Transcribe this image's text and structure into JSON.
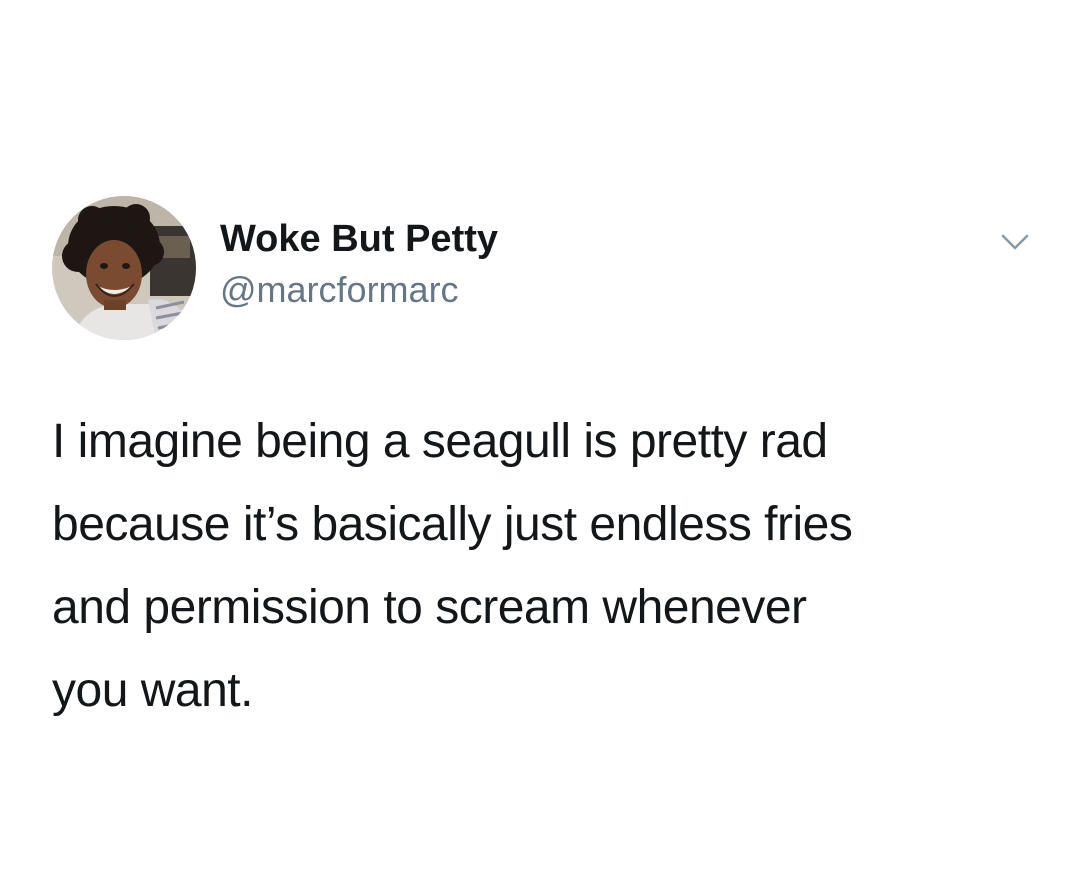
{
  "tweet": {
    "author": {
      "display_name": "Woke But Petty",
      "handle": "@marcformarc",
      "avatar_icon": "profile-photo"
    },
    "menu_icon": "chevron-down-icon",
    "text": "I imagine being a seagull is pretty rad\nbecause it’s basically just endless fries\nand permission to scream whenever\nyou want.",
    "colors": {
      "text": "#14171a",
      "handle": "#657786",
      "chevron": "#8899a6",
      "background": "#ffffff"
    }
  }
}
